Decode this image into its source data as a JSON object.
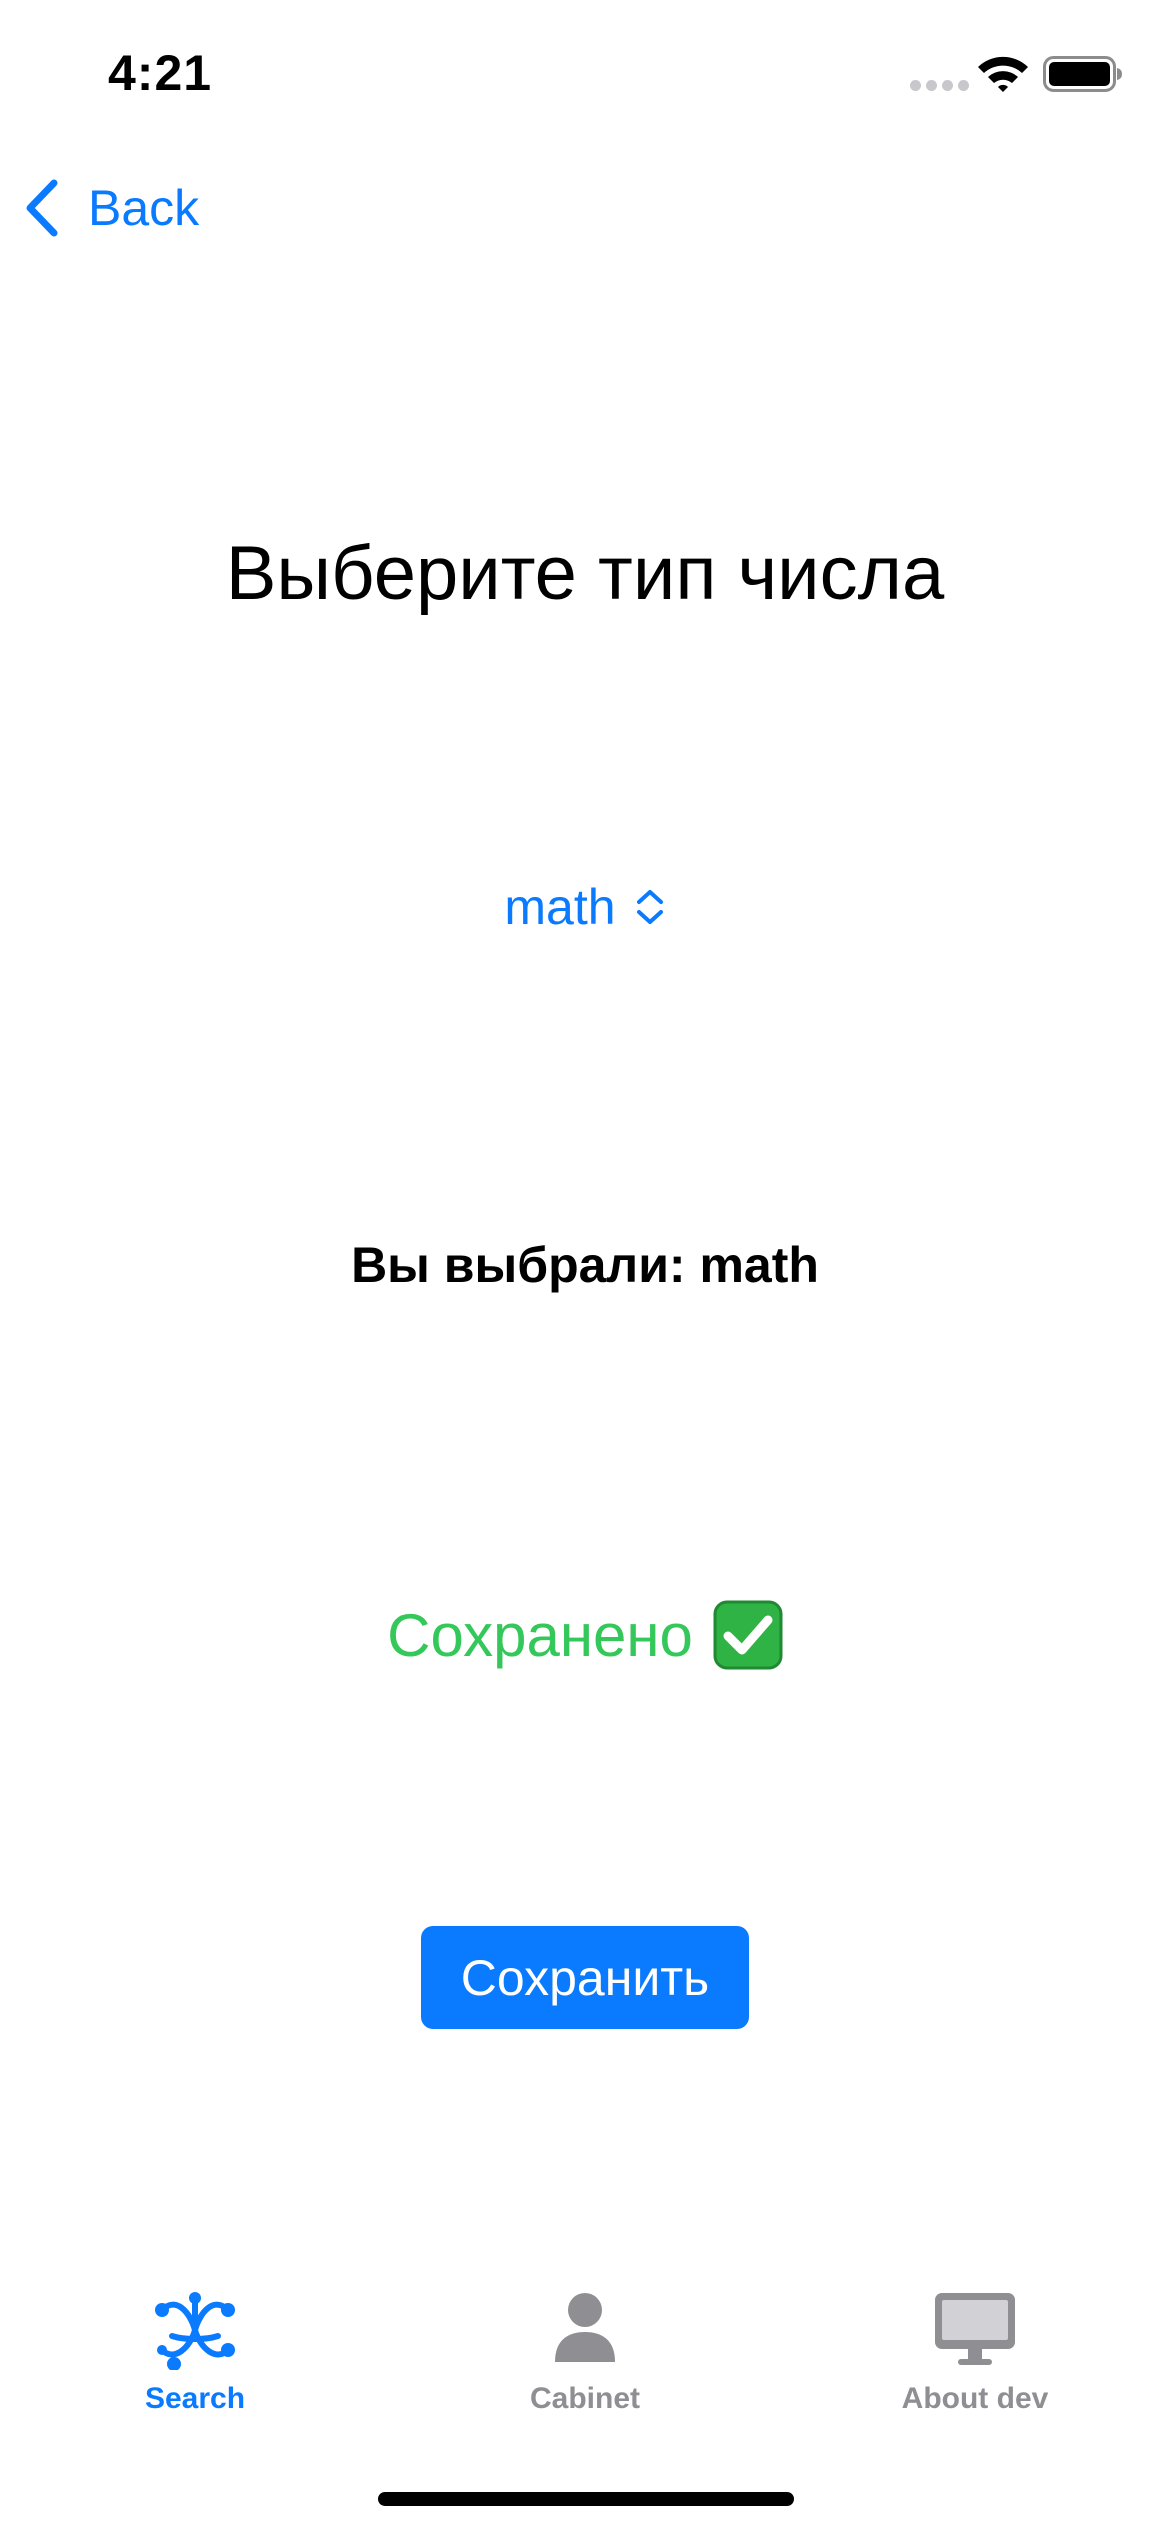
{
  "status_bar": {
    "time": "4:21"
  },
  "nav": {
    "back_label": "Back",
    "back_icon": "chevron-left-icon"
  },
  "main": {
    "title": "Выберите тип числа",
    "picker_value": "math",
    "picker_icon": "chevron-up-down-icon",
    "selection_text": "Вы выбрали: math",
    "saved_text": "Сохранено",
    "saved_icon": "check-mark-button-icon",
    "save_button_label": "Сохранить"
  },
  "tab_bar": {
    "tabs": [
      {
        "label": "Search",
        "icon": "atom-icon",
        "selected": true
      },
      {
        "label": "Cabinet",
        "icon": "person-icon",
        "selected": false
      },
      {
        "label": "About dev",
        "icon": "desktop-computer-icon",
        "selected": false
      }
    ]
  },
  "colors": {
    "accent": "#0a7aff",
    "success": "#34c759",
    "inactive_tab": "#8e8e93"
  }
}
